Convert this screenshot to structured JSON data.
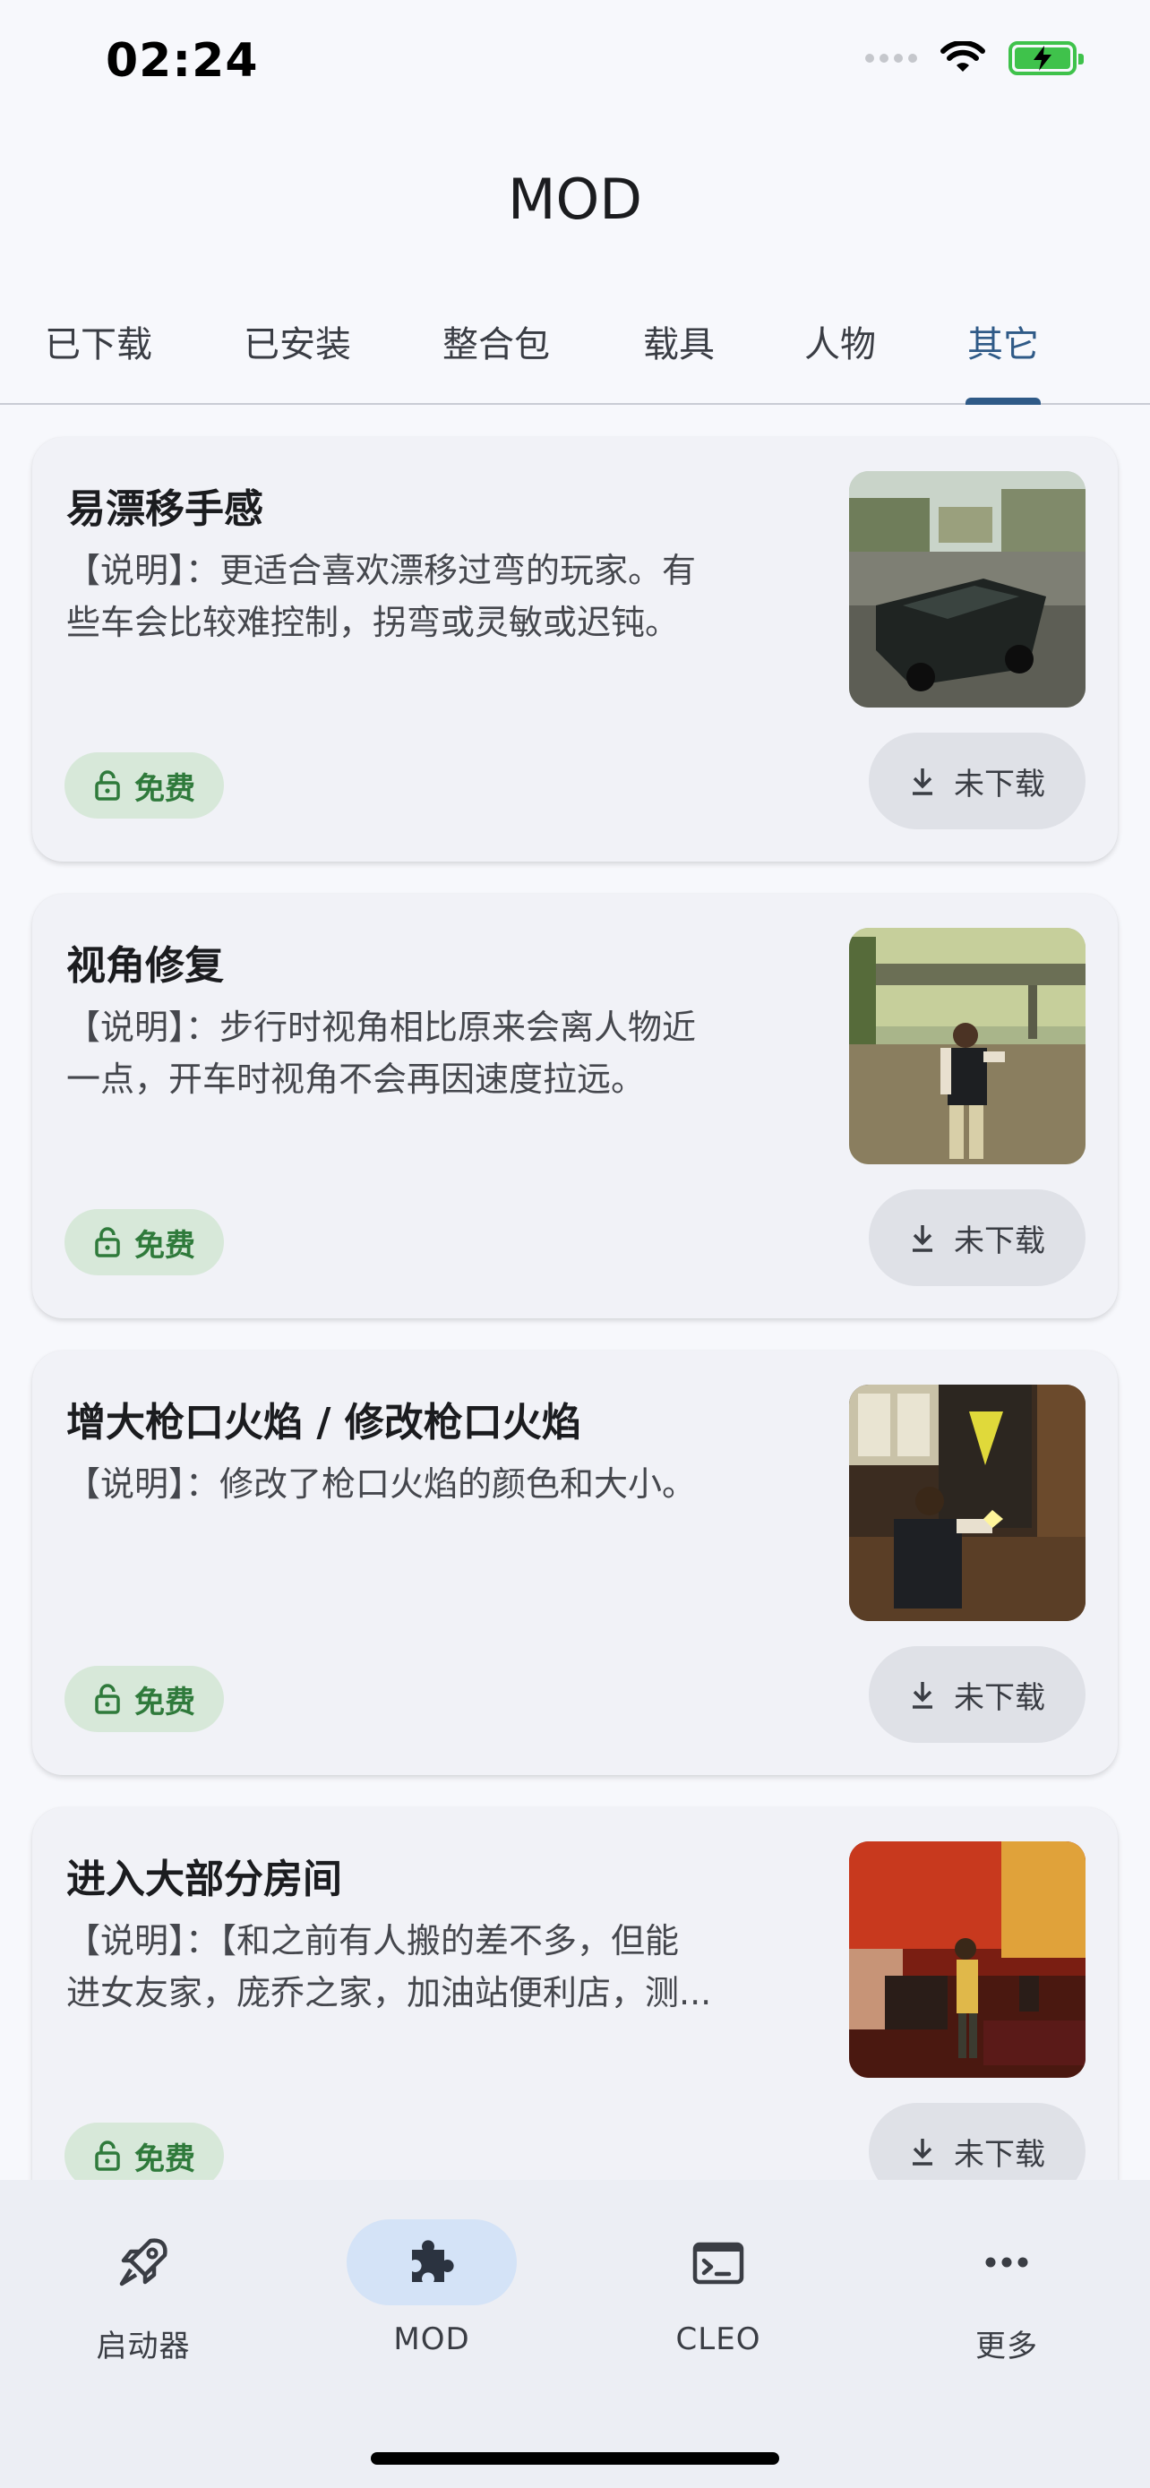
{
  "status_bar": {
    "time": "02:24"
  },
  "header": {
    "title": "MOD"
  },
  "tabs": [
    {
      "label": "已下载"
    },
    {
      "label": "已安装"
    },
    {
      "label": "整合包"
    },
    {
      "label": "载具"
    },
    {
      "label": "人物"
    },
    {
      "label": "其它",
      "active": true
    }
  ],
  "mods": [
    {
      "title": "易漂移手感",
      "desc_line1": "【说明】：更适合喜欢漂移过弯的玩家。有",
      "desc_line2": "些车会比较难控制，拐弯或灵敏或迟钝。",
      "badge": "免费",
      "download_label": "未下载",
      "thumb_icon": "car-scene-image"
    },
    {
      "title": "视角修复",
      "desc_line1": "【说明】：步行时视角相比原来会离人物近",
      "desc_line2": "一点，开车时视角不会再因速度拉远。",
      "badge": "免费",
      "download_label": "未下载",
      "thumb_icon": "street-scene-image"
    },
    {
      "title": "增大枪口火焰 / 修改枪口火焰",
      "desc_line1": "【说明】：修改了枪口火焰的颜色和大小。",
      "desc_line2": "",
      "badge": "免费",
      "download_label": "未下载",
      "thumb_icon": "indoor-shooting-image"
    },
    {
      "title": "进入大部分房间",
      "desc_line1": "【说明】：【和之前有人搬的差不多，但能",
      "desc_line2": "进女友家，庞乔之家，加油站便利店，测...",
      "badge": "免费",
      "download_label": "未下载",
      "thumb_icon": "red-room-image"
    }
  ],
  "bottom_nav": [
    {
      "label": "启动器",
      "icon": "rocket-icon"
    },
    {
      "label": "MOD",
      "icon": "puzzle-icon",
      "active": true
    },
    {
      "label": "CLEO",
      "icon": "terminal-icon"
    },
    {
      "label": "更多",
      "icon": "more-dots-icon"
    }
  ],
  "colors": {
    "accent": "#2f5a87",
    "free_badge_bg": "#d7e8d9",
    "free_badge_text": "#2f7a3b",
    "battery": "#3fc24b"
  }
}
